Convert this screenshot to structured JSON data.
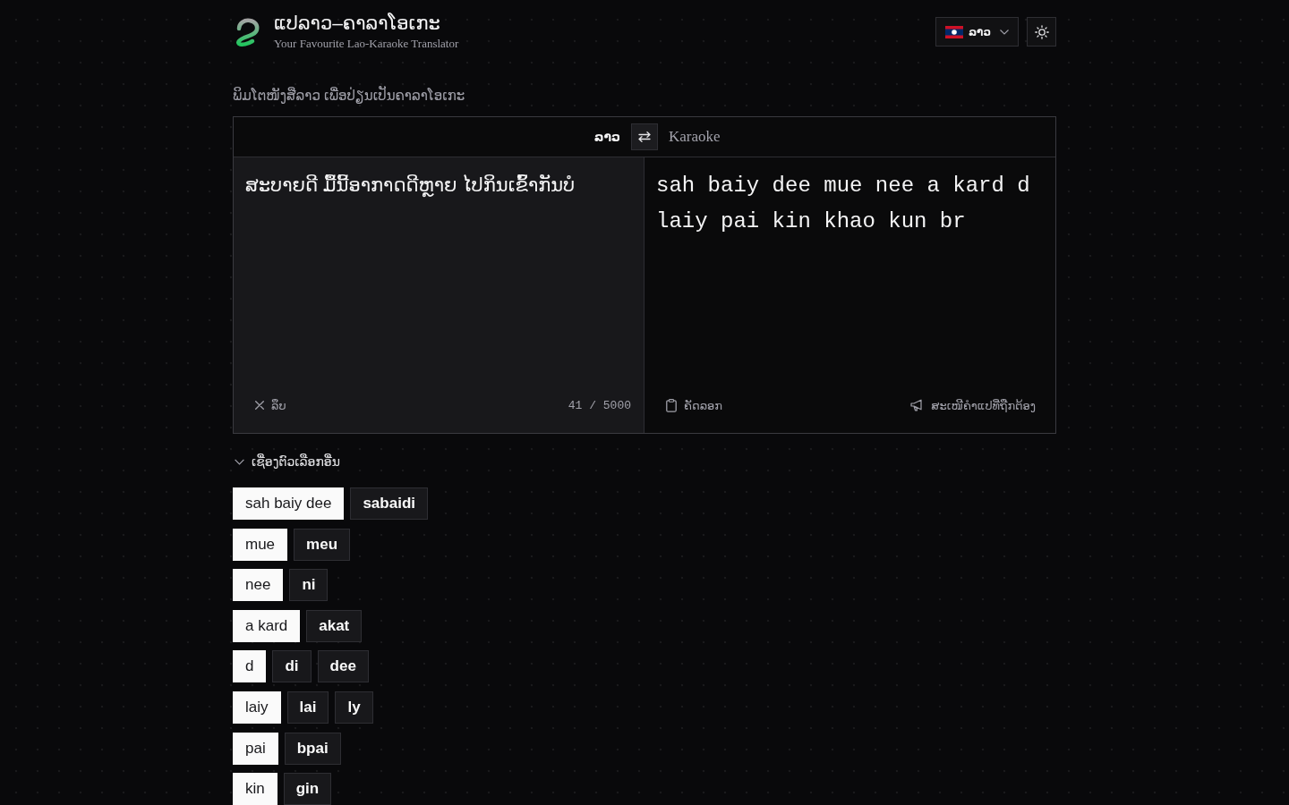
{
  "header": {
    "title": "ແປລາວ–ຄາລາໂອເກະ",
    "subtitle": "Your Favourite Lao-Karaoke Translator",
    "language_button": {
      "label": "ລາວ"
    }
  },
  "prompt": "ພິມໂຕໜັງສືລາວ ເພື່ອປ່ຽນເປັນຄາລາໂອເກະ",
  "translator": {
    "source_language": "ລາວ",
    "target_language": "Karaoke",
    "input": {
      "value": "ສະບາຍດີ ມື້ນີ້ອາກາດດີຫຼາຍ ໄປກິນເຂົ້າກັນບໍ"
    },
    "output": "sah baiy dee mue nee a kard d laiy pai kin khao kun br",
    "clear_label": "ລຶບ",
    "char_count": "41 / 5000",
    "copy_label": "ຄັດລອກ",
    "suggest_label": "ສະເໜີຄຳແປທີ່ຖືກຕ້ອງ"
  },
  "options": {
    "toggle_label": "ເຊື່ອງຕົວເລືອກອື່ນ",
    "expanded": true,
    "rows": [
      {
        "choices": [
          {
            "text": "sah baiy dee",
            "selected": true
          },
          {
            "text": "sabaidi",
            "selected": false
          }
        ]
      },
      {
        "choices": [
          {
            "text": "mue",
            "selected": true
          },
          {
            "text": "meu",
            "selected": false
          }
        ]
      },
      {
        "choices": [
          {
            "text": "nee",
            "selected": true
          },
          {
            "text": "ni",
            "selected": false
          }
        ]
      },
      {
        "choices": [
          {
            "text": "a kard",
            "selected": true
          },
          {
            "text": "akat",
            "selected": false
          }
        ]
      },
      {
        "choices": [
          {
            "text": "d",
            "selected": true
          },
          {
            "text": "di",
            "selected": false
          },
          {
            "text": "dee",
            "selected": false
          }
        ]
      },
      {
        "choices": [
          {
            "text": "laiy",
            "selected": true
          },
          {
            "text": "lai",
            "selected": false
          },
          {
            "text": "ly",
            "selected": false
          }
        ]
      },
      {
        "choices": [
          {
            "text": "pai",
            "selected": true
          },
          {
            "text": "bpai",
            "selected": false
          }
        ]
      },
      {
        "choices": [
          {
            "text": "kin",
            "selected": true
          },
          {
            "text": "gin",
            "selected": false
          }
        ]
      }
    ]
  }
}
